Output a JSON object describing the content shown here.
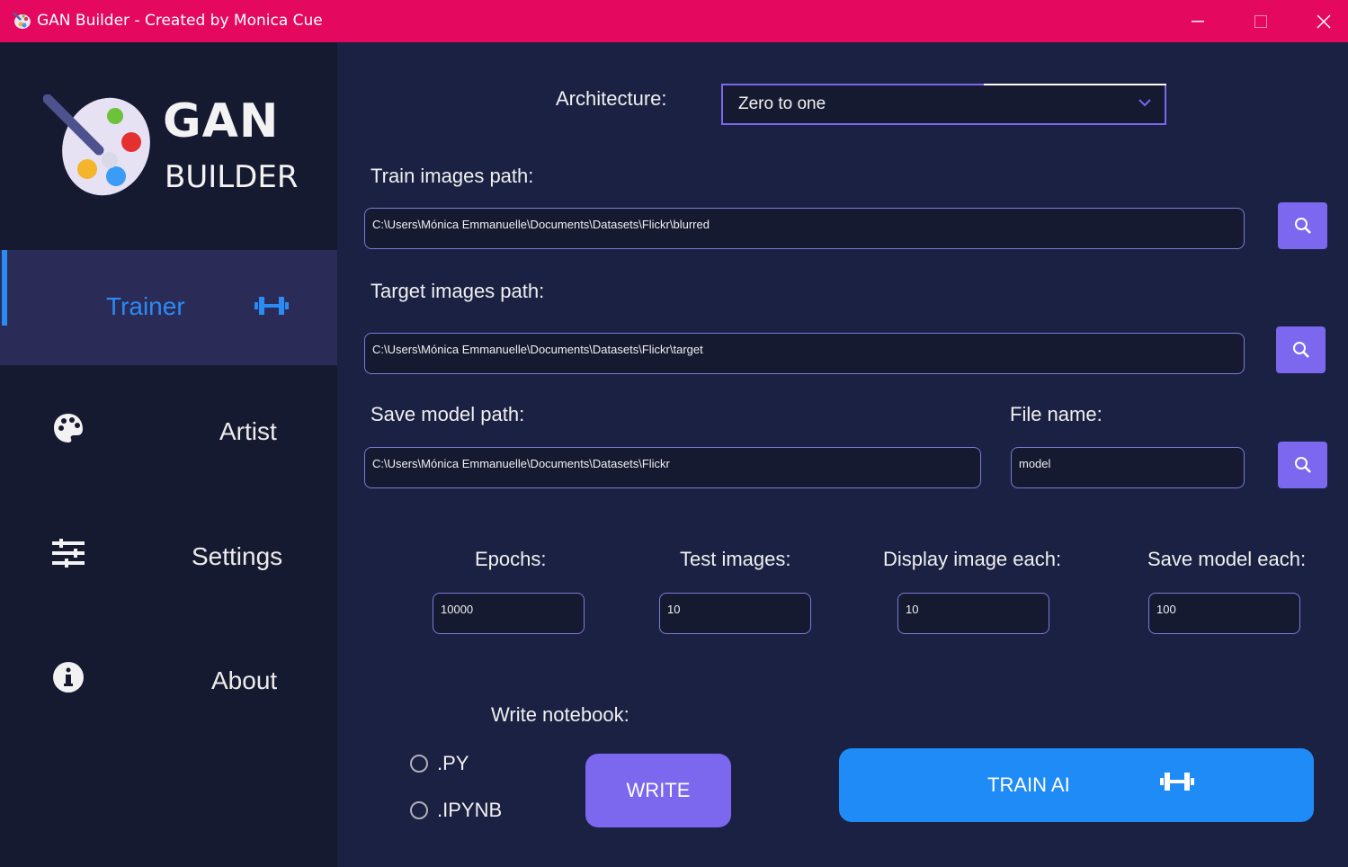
{
  "window": {
    "title": "GAN Builder - Created by Monica Cue",
    "colors": {
      "titlebar": "#e5085f",
      "sidebar": "#161a30",
      "main": "#1b2142",
      "accent": "#7b68ee",
      "blue": "#1e8bf6"
    }
  },
  "logo": {
    "line1": "GAN",
    "line2": "BUILDER"
  },
  "sidebar": {
    "items": [
      {
        "label": "Trainer",
        "icon": "dumbbell-icon",
        "active": true
      },
      {
        "label": "Artist",
        "icon": "palette-icon"
      },
      {
        "label": "Settings",
        "icon": "sliders-icon"
      },
      {
        "label": "About",
        "icon": "info-icon"
      }
    ]
  },
  "form": {
    "architecture": {
      "label": "Architecture:",
      "value": "Zero to one"
    },
    "train_path": {
      "label": "Train images path:",
      "value": "C:\\Users\\Mónica Emmanuelle\\Documents\\Datasets\\Flickr\\blurred"
    },
    "target_path": {
      "label": "Target images path:",
      "value": "C:\\Users\\Mónica Emmanuelle\\Documents\\Datasets\\Flickr\\target"
    },
    "save_path": {
      "label": "Save model path:",
      "value": "C:\\Users\\Mónica Emmanuelle\\Documents\\Datasets\\Flickr"
    },
    "file_name": {
      "label": "File name:",
      "value": "model"
    },
    "epochs": {
      "label": "Epochs:",
      "value": "10000"
    },
    "test_images": {
      "label": "Test images:",
      "value": "10"
    },
    "display_each": {
      "label": "Display image each:",
      "value": "10"
    },
    "save_each": {
      "label": "Save model each:",
      "value": "100"
    },
    "notebook": {
      "label": "Write notebook:",
      "options": [
        ".PY",
        ".IPYNB"
      ]
    },
    "write_label": "WRITE",
    "train_label": "TRAIN AI"
  }
}
